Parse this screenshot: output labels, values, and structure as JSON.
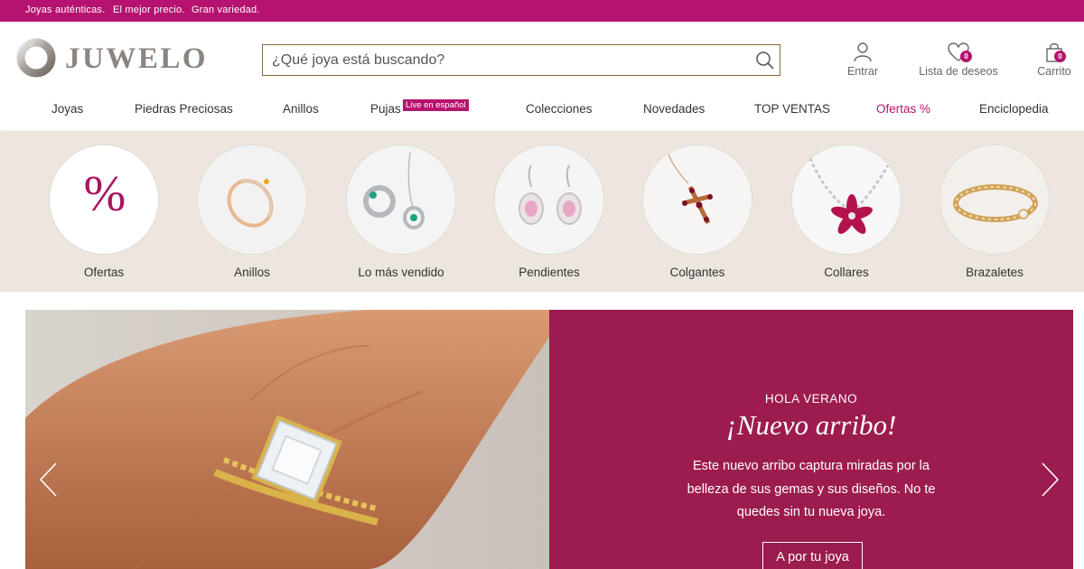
{
  "topbar": {
    "items": [
      "Joyas auténticas.",
      "El mejor precio.",
      "Gran variedad."
    ]
  },
  "header": {
    "brand": "JUWELO",
    "search": {
      "placeholder": "¿Qué joya está buscando?"
    },
    "account_label": "Entrar",
    "wishlist_label": "Lista de deseos",
    "wishlist_count": "0",
    "cart_label": "Carrito",
    "cart_count": "0"
  },
  "nav": {
    "items": [
      "Joyas",
      "Piedras Preciosas",
      "Anillos",
      "Pujas",
      "Colecciones",
      "Novedades",
      "TOP VENTAS",
      "Ofertas %",
      "Enciclopedia"
    ],
    "live_badge": "Live en español"
  },
  "categories": {
    "items": [
      "Ofertas",
      "Anillos",
      "Lo más vendido",
      "Pendientes",
      "Colgantes",
      "Collares",
      "Brazaletes"
    ],
    "offer_symbol": "%"
  },
  "hero": {
    "kicker": "HOLA VERANO",
    "title": "¡Nuevo arribo!",
    "text": "Este nuevo arribo captura miradas por la belleza de sus gemas y sus diseños. No te quedes sin tu nueva joya.",
    "cta": "A por tu joya"
  },
  "icons": {
    "search": "search-icon",
    "account": "user-icon",
    "wishlist": "heart-icon",
    "cart": "shopping-bag-icon",
    "prev": "chevron-left-icon",
    "next": "chevron-right-icon"
  },
  "colors": {
    "brand": "#b5136f",
    "hero_panel": "#9c1c4f",
    "category_band": "#ede6de",
    "logo": "#8c8480"
  }
}
